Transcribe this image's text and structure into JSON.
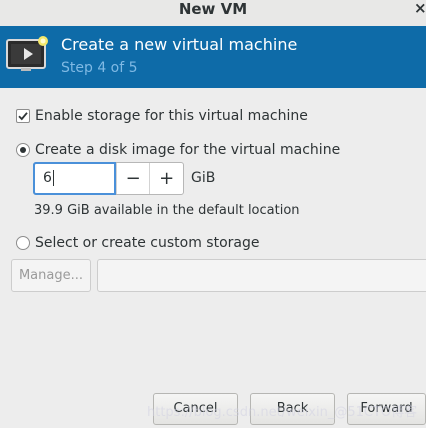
{
  "window": {
    "title": "New VM",
    "close_glyph": "×"
  },
  "banner": {
    "heading": "Create a new virtual machine",
    "step": "Step 4 of 5",
    "icon": "vm-display-icon",
    "color": "#0e6ba8"
  },
  "storage": {
    "enable_label": "Enable storage for this virtual machine",
    "enable_checked": true,
    "create_disk_label": "Create a disk image for the virtual machine",
    "create_disk_selected": true,
    "size_value": "6",
    "decrement_glyph": "−",
    "increment_glyph": "+",
    "size_unit": "GiB",
    "available_text": "39.9 GiB available in the default location",
    "custom_label": "Select or create custom storage",
    "custom_selected": false,
    "manage_label": "Manage...",
    "custom_path_value": ""
  },
  "footer": {
    "cancel_label": "Cancel",
    "back_label": "Back",
    "forward_label": "Forward"
  },
  "watermark": {
    "text": "https://blog.csdn.net/weixin_@51CTO博客"
  }
}
